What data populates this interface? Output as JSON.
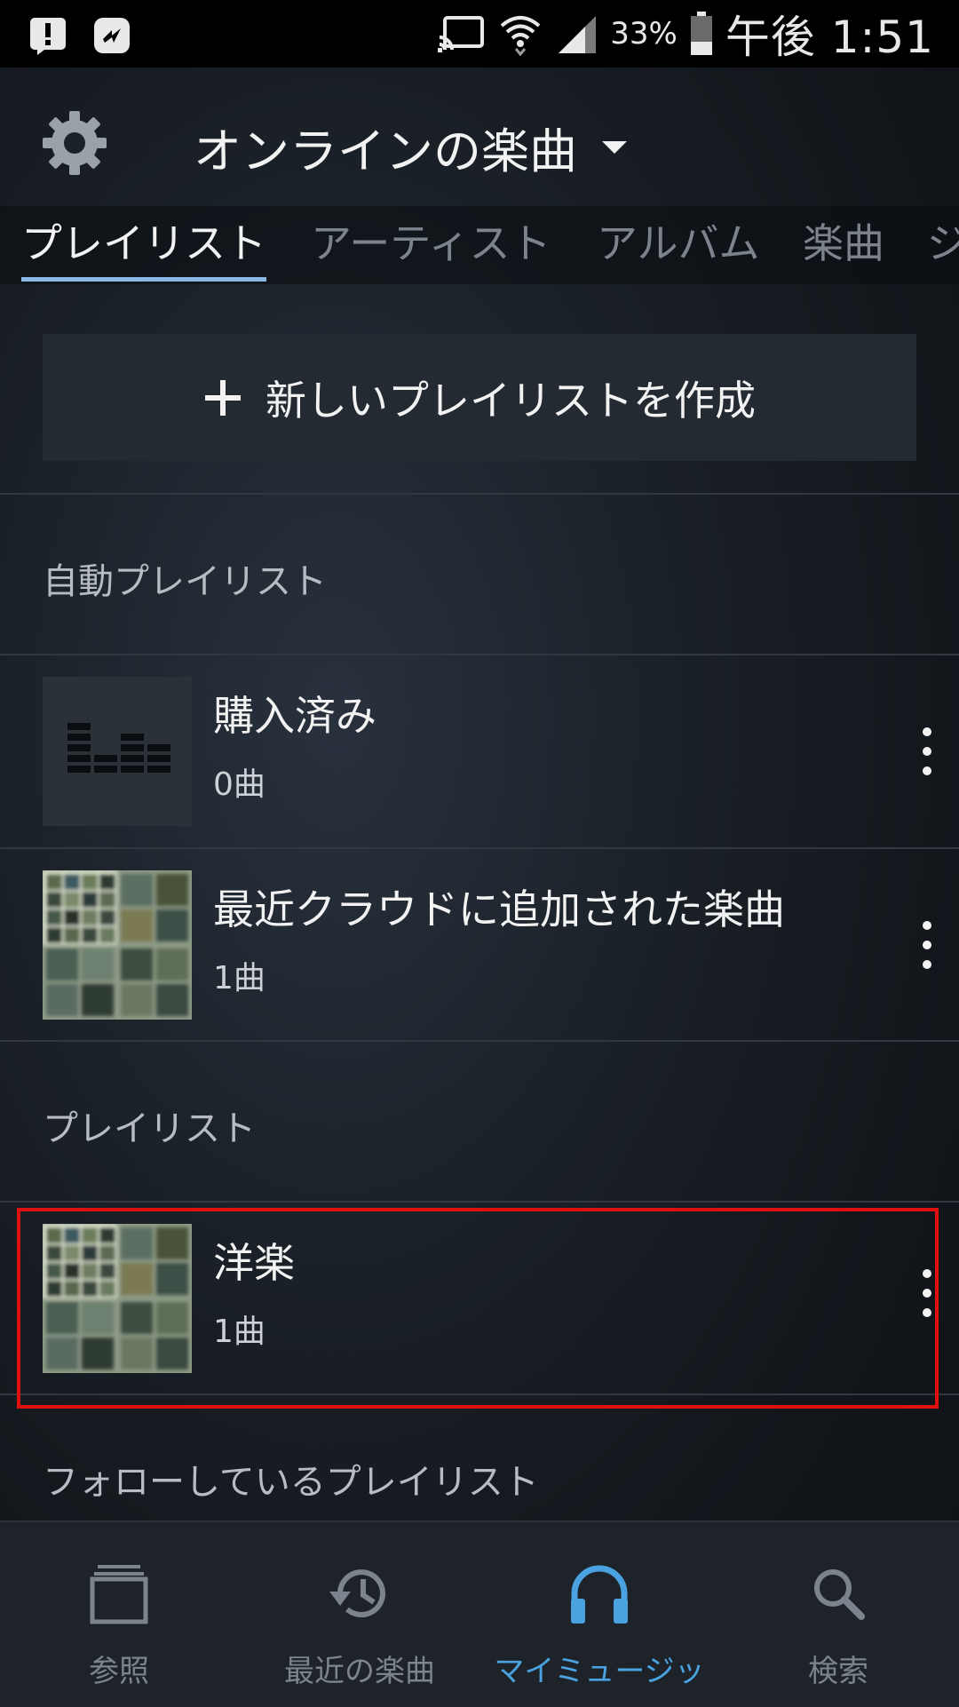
{
  "status_bar": {
    "battery": "33%",
    "time": "午後 1:51"
  },
  "header": {
    "title": "オンラインの楽曲"
  },
  "tabs": [
    {
      "label": "プレイリスト",
      "active": true
    },
    {
      "label": "アーティスト",
      "active": false
    },
    {
      "label": "アルバム",
      "active": false
    },
    {
      "label": "楽曲",
      "active": false
    },
    {
      "label": "ジ",
      "active": false
    }
  ],
  "new_playlist": {
    "label": "新しいプレイリストを作成"
  },
  "sections": {
    "auto": "自動プレイリスト",
    "playlists": "プレイリスト",
    "following": "フォローしているプレイリスト"
  },
  "auto_playlists": [
    {
      "title": "購入済み",
      "count": "0曲"
    },
    {
      "title": "最近クラウドに追加された楽曲",
      "count": "1曲"
    }
  ],
  "user_playlists": [
    {
      "title": "洋楽",
      "count": "1曲"
    }
  ],
  "bottom_nav": [
    {
      "label": "参照",
      "icon": "browse-icon"
    },
    {
      "label": "最近の楽曲",
      "icon": "history-icon"
    },
    {
      "label": "マイミュージッ",
      "icon": "headphones-icon",
      "active": true
    },
    {
      "label": "検索",
      "icon": "search-icon"
    }
  ],
  "colors": {
    "accent": "#4aa3e0",
    "tab_underline": "#8ab8e6",
    "highlight": "#e01010"
  }
}
